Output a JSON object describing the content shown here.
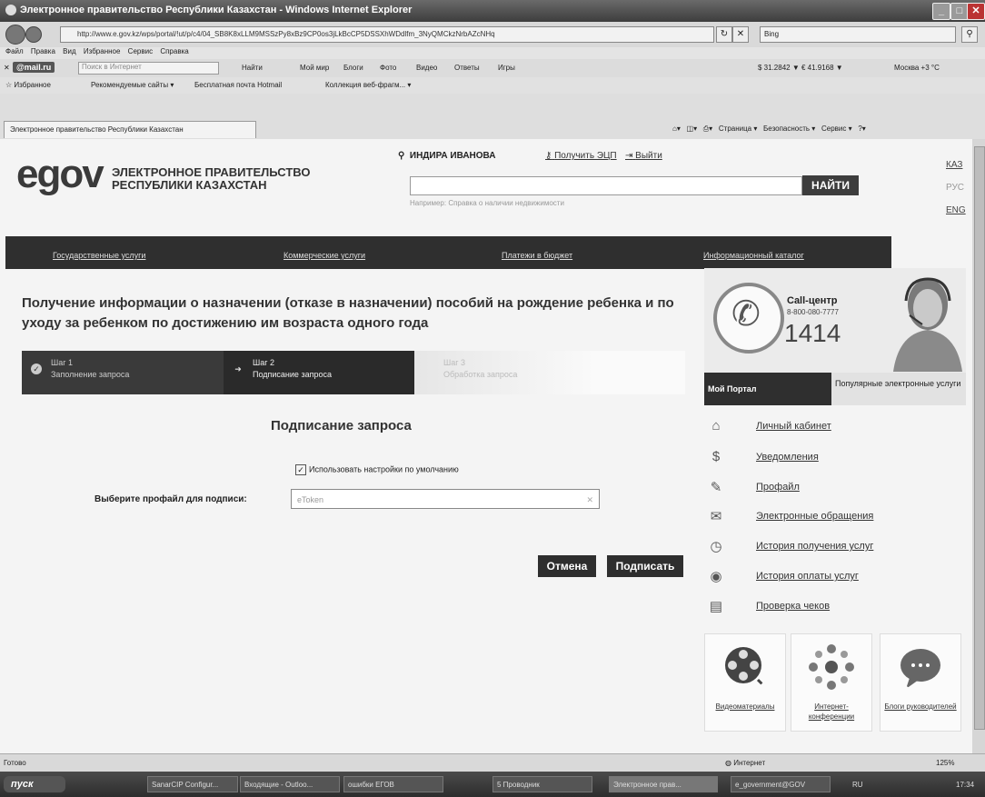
{
  "window": {
    "title": "Электронное правительство Республики Казахстан - Windows Internet Explorer"
  },
  "browser": {
    "url_host": "e.gov.kz",
    "url": "http://www.e.gov.kz/wps/portal/!ut/p/c4/04_SB8K8xLLM9MSSzPy8xBz9CP0os3jLkBcCP5DSSXhWDdlfm_3NyQMCkzNrbAZcNHq",
    "search_engine": "Bing",
    "menu": [
      "Файл",
      "Правка",
      "Вид",
      "Избранное",
      "Сервис",
      "Справка"
    ],
    "mail_label": "@mail.ru",
    "search_placeholder": "Поиск в Интернет",
    "toolbar_items": [
      "Найти",
      "Мой мир",
      "Блоги",
      "Фото",
      "Видео",
      "Ответы",
      "Игры"
    ],
    "currency": "$ 31.2842 ▼  € 41.9168 ▼",
    "weather": "Москва +3 °С",
    "favorites_label": "Избранное",
    "favorites_items": [
      "Рекомендуемые сайты ▾",
      "Бесплатная почта Hotmail",
      "Коллекция веб-фрагм... ▾"
    ],
    "tab_title": "Электронное правительство Республики Казахстан",
    "tab_tools": [
      "Страница ▾",
      "Безопасность ▾",
      "Сервис ▾",
      "?▾"
    ]
  },
  "site": {
    "logo_text": "egov",
    "logo_tagline_1": "ЭЛЕКТРОННОЕ ПРАВИТЕЛЬСТВО",
    "logo_tagline_2": "РЕСПУБЛИКИ КАЗАХСТАН",
    "user_name": "ИНДИРА ИВАНОВА",
    "get_ecp": "Получить ЭЦП",
    "logout": "Выйти",
    "search_button": "НАЙТИ",
    "search_example": "Например: Справка о наличии недвижимости",
    "languages": [
      "КАЗ",
      "РУС",
      "ENG"
    ],
    "nav": [
      "Государственные услуги",
      "Коммерческие услуги",
      "Платежи в бюджет",
      "Информационный каталог"
    ]
  },
  "main": {
    "heading": "Получение информации о назначении (отказе в назначении) пособий на рождение ребенка и по уходу за ребенком по достижению им возраста одного года",
    "steps": [
      {
        "num": "Шаг 1",
        "desc": "Заполнение запроса"
      },
      {
        "num": "Шаг 2",
        "desc": "Подписание запроса"
      },
      {
        "num": "Шаг 3",
        "desc": "Обработка запроса"
      }
    ],
    "form_title": "Подписание запроса",
    "default_settings_label": "Использовать настройки по умолчанию",
    "profile_label": "Выберите профайл для подписи:",
    "profile_value": "eToken",
    "cancel_label": "Отмена",
    "sign_label": "Подписать"
  },
  "sidebar": {
    "call_title": "Call-центр",
    "call_phone": "8-800-080-7777",
    "call_short": "1414",
    "tab_my": "Мой Портал",
    "tab_popular": "Популярные электронные услуги",
    "items": [
      {
        "label": "Личный кабинет",
        "icon": "home-icon"
      },
      {
        "label": "Уведомления",
        "icon": "dollar-icon"
      },
      {
        "label": "Профайл",
        "icon": "pen-icon"
      },
      {
        "label": "Электронные обращения",
        "icon": "bubble-icon"
      },
      {
        "label": "История получения услуг",
        "icon": "clock-icon"
      },
      {
        "label": "История оплаты услуг",
        "icon": "coin-icon"
      },
      {
        "label": "Проверка чеков",
        "icon": "receipt-icon"
      }
    ],
    "tiles": [
      {
        "label": "Видеоматериалы",
        "icon": "film-reel-icon"
      },
      {
        "label": "Интернет-конференции",
        "icon": "network-icon"
      },
      {
        "label": "Блоги руководителей",
        "icon": "chat-icon"
      }
    ]
  },
  "statusbar": {
    "left": "Готово",
    "zone": "Интернет",
    "zoom": "125%"
  },
  "taskbar": {
    "start": "пуск",
    "tasks": [
      "SanarCIP Configur...",
      "Входящие - Outloo...",
      "ошибки ЕГОВ",
      "5 Проводник",
      "Электронное прав...",
      "e_government@GOV"
    ],
    "lang": "RU",
    "time": "17:34"
  }
}
